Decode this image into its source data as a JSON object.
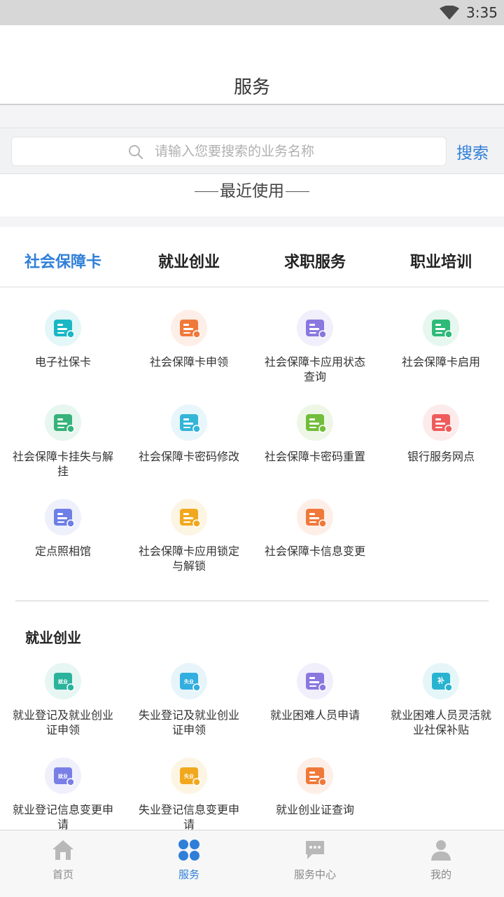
{
  "status_bar": {
    "time": "3:35"
  },
  "app_bar": {
    "title": "服务"
  },
  "search": {
    "placeholder": "请输入您要搜索的业务名称",
    "value": "",
    "button_label": "搜索"
  },
  "recent": {
    "label": "最近使用"
  },
  "tabs": [
    {
      "label": "社会保障卡",
      "active": true
    },
    {
      "label": "就业创业",
      "active": false
    },
    {
      "label": "求职服务",
      "active": false
    },
    {
      "label": "职业培训",
      "active": false
    }
  ],
  "social_card_services": [
    {
      "label": "电子社保卡",
      "icon": "id-card-icon",
      "color": "#19b7c5"
    },
    {
      "label": "社会保障卡申领",
      "icon": "card-apply-icon",
      "color": "#f0793a"
    },
    {
      "label": "社会保障卡应用状态查询",
      "icon": "card-search-icon",
      "color": "#8a78e0"
    },
    {
      "label": "社会保障卡启用",
      "icon": "card-enable-icon",
      "color": "#2fba78"
    },
    {
      "label": "社会保障卡挂失与解挂",
      "icon": "card-loss-icon",
      "color": "#36b27a"
    },
    {
      "label": "社会保障卡密码修改",
      "icon": "lock-edit-icon",
      "color": "#33b5d8"
    },
    {
      "label": "社会保障卡密码重置",
      "icon": "lock-reset-icon",
      "color": "#72bd3b"
    },
    {
      "label": "银行服务网点",
      "icon": "bank-icon",
      "color": "#ef5b5b"
    },
    {
      "label": "定点照相馆",
      "icon": "photo-studio-icon",
      "color": "#6e7fe6"
    },
    {
      "label": "社会保障卡应用锁定与解锁",
      "icon": "card-lock-icon",
      "color": "#f2a81e"
    },
    {
      "label": "社会保障卡信息变更",
      "icon": "card-change-icon",
      "color": "#f0793a"
    }
  ],
  "employment_section": {
    "title": "就业创业",
    "items": [
      {
        "label": "就业登记及就业创业证申领",
        "icon": "employment-register-icon",
        "color": "#2bb39c",
        "badge": "就业"
      },
      {
        "label": "失业登记及就业创业证申领",
        "icon": "unemployment-register-icon",
        "color": "#33aee0",
        "badge": "失业"
      },
      {
        "label": "就业困难人员申请",
        "icon": "briefcase-icon",
        "color": "#8a78e0",
        "badge": ""
      },
      {
        "label": "就业困难人员灵活就业社保补贴",
        "icon": "money-bag-icon",
        "color": "#28b3d1",
        "badge": "补"
      },
      {
        "label": "就业登记信息变更申请",
        "icon": "employment-change-icon",
        "color": "#7a7fe6",
        "badge": "就业"
      },
      {
        "label": "失业登记信息变更申请",
        "icon": "unemployment-change-icon",
        "color": "#f2a81e",
        "badge": "失业"
      },
      {
        "label": "就业创业证查询",
        "icon": "certificate-query-icon",
        "color": "#f0793a",
        "badge": ""
      }
    ]
  },
  "bottom_nav": [
    {
      "label": "首页",
      "icon": "home-icon",
      "active": false
    },
    {
      "label": "服务",
      "icon": "grid-icon",
      "active": true
    },
    {
      "label": "服务中心",
      "icon": "chat-icon",
      "active": false
    },
    {
      "label": "我的",
      "icon": "user-icon",
      "active": false
    }
  ]
}
